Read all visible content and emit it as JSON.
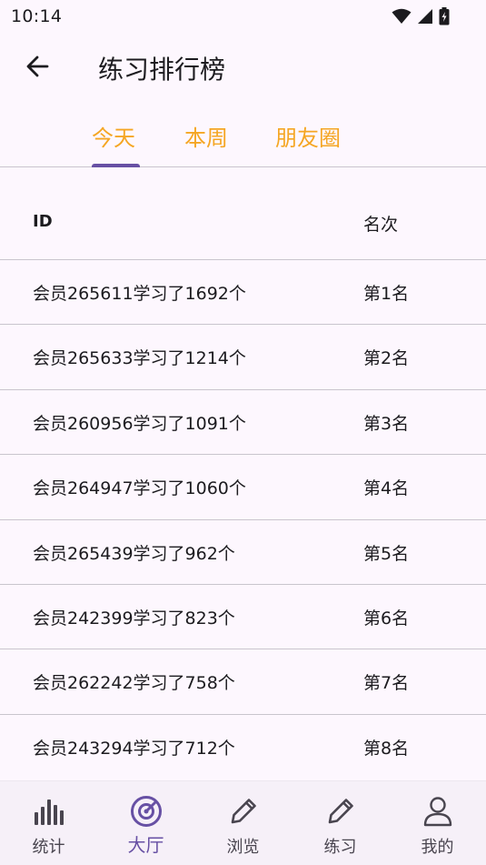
{
  "status_bar": {
    "time": "10:14"
  },
  "app_bar": {
    "title": "练习排行榜"
  },
  "tabs": [
    {
      "label": "今天",
      "selected": true
    },
    {
      "label": "本周",
      "selected": false
    },
    {
      "label": "朋友圈",
      "selected": false
    }
  ],
  "table": {
    "headers": {
      "id": "ID",
      "rank": "名次"
    },
    "rows": [
      {
        "name": "会员265611学习了1692个",
        "rank": "第1名"
      },
      {
        "name": "会员265633学习了1214个",
        "rank": "第2名"
      },
      {
        "name": "会员260956学习了1091个",
        "rank": "第3名"
      },
      {
        "name": "会员264947学习了1060个",
        "rank": "第4名"
      },
      {
        "name": "会员265439学习了962个",
        "rank": "第5名"
      },
      {
        "name": "会员242399学习了823个",
        "rank": "第6名"
      },
      {
        "name": "会员262242学习了758个",
        "rank": "第7名"
      },
      {
        "name": "会员243294学习了712个",
        "rank": "第8名"
      }
    ]
  },
  "bottom_nav": [
    {
      "label": "统计",
      "icon": "bar-chart-icon",
      "active": false
    },
    {
      "label": "大厅",
      "icon": "target-icon",
      "active": true
    },
    {
      "label": "浏览",
      "icon": "pencil-icon",
      "active": false
    },
    {
      "label": "练习",
      "icon": "pencil-icon",
      "active": false
    },
    {
      "label": "我的",
      "icon": "person-icon",
      "active": false
    }
  ],
  "colors": {
    "background": "#FDF7FE",
    "tab_text": "#F5A623",
    "accent": "#6750A4",
    "nav_background": "#F6F0F8"
  }
}
